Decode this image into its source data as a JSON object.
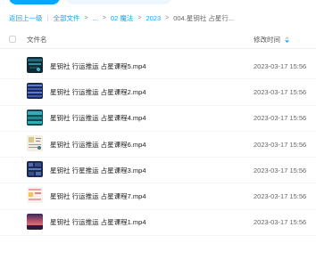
{
  "breadcrumb": {
    "back": "返回上一级",
    "all_files": "全部文件",
    "ellipsis": "...",
    "folder_1": "02 魔法",
    "folder_2": "2023",
    "current": "004.星钥社 占星行..."
  },
  "header": {
    "name_label": "文件名",
    "time_label": "修改时间"
  },
  "files": [
    {
      "name": "星钥社 行运推运 占星课程5.mp4",
      "time": "2023-03-17 15:56",
      "thumb": "dark-teal"
    },
    {
      "name": "星钥社 行运推运 占星课程2.mp4",
      "time": "2023-03-17 15:56",
      "thumb": "blue-chart"
    },
    {
      "name": "星钥社 行运推运 占星课程4.mp4",
      "time": "2023-03-17 15:56",
      "thumb": "teal-chart"
    },
    {
      "name": "星钥社 行运推运 占星课程6.mp4",
      "time": "2023-03-17 15:56",
      "thumb": "light-doc"
    },
    {
      "name": "星钥社 行星推运 占星课程3.mp4",
      "time": "2023-03-17 15:56",
      "thumb": "navy-grid"
    },
    {
      "name": "星钥社 行运推运 占星课程7.mp4",
      "time": "2023-03-17 15:56",
      "thumb": "pink-doc"
    },
    {
      "name": "星钥社 行运推运 占星课程1.mp4",
      "time": "2023-03-17 15:56",
      "thumb": "sunset"
    }
  ],
  "colors": {
    "accent": "#06a7ff"
  }
}
